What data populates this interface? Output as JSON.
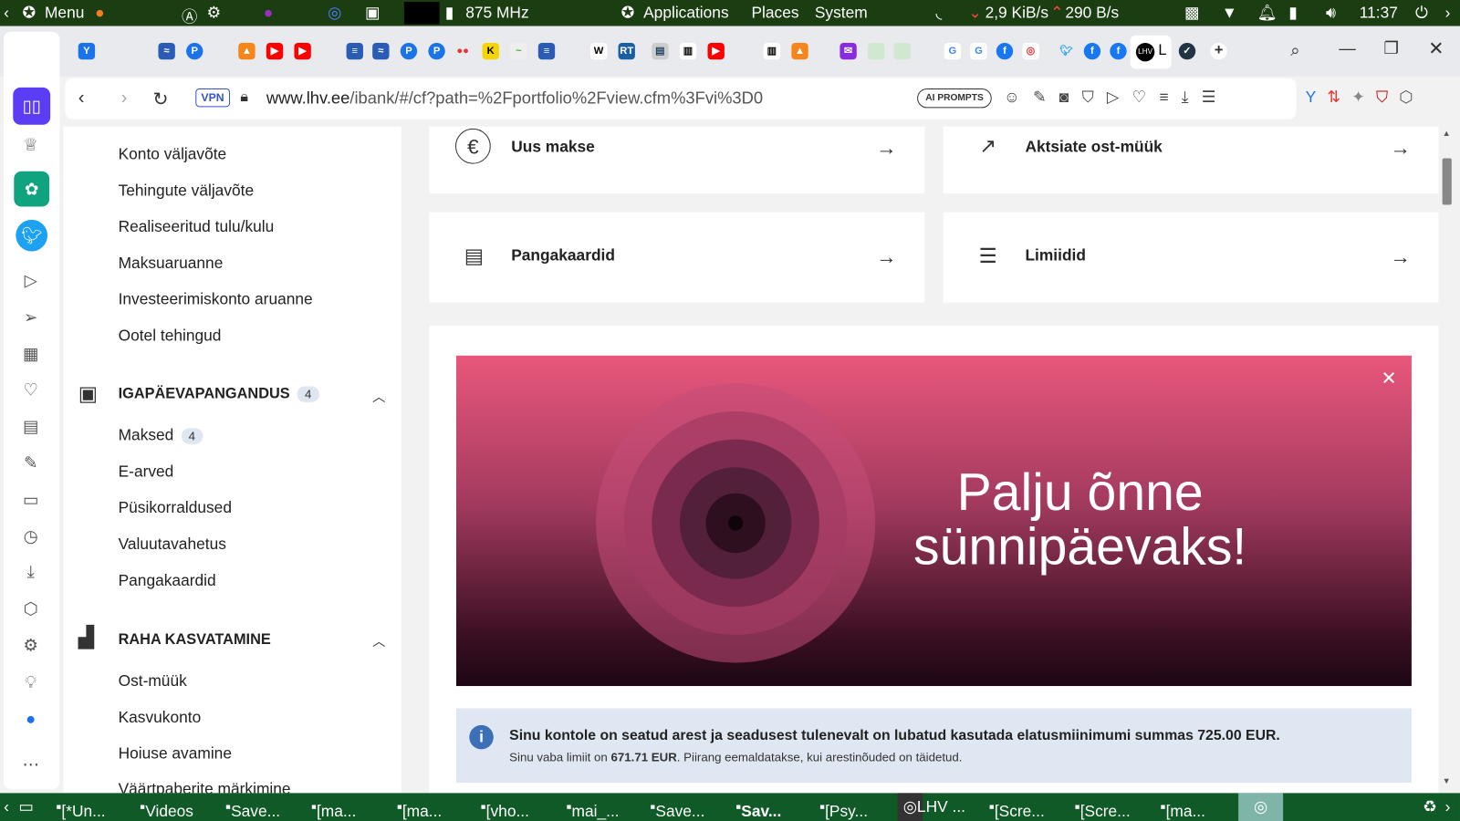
{
  "system_bar": {
    "menu": "Menu",
    "cpu": "875 MHz",
    "applications": "Applications",
    "places": "Places",
    "system": "System",
    "net_down": "2,9 KiB/s",
    "net_up": "290 B/s",
    "time": "11:37"
  },
  "browser": {
    "vpn": "VPN",
    "url_domain": "www.lhv.ee",
    "url_path": "/ibank/#/cf?path=%2Fportfolio%2Fview.cfm%3Fvi%3D0",
    "ai_prompts": "AI PROMPTS"
  },
  "sidebar": {
    "items_top": [
      "Konto väljavõte",
      "Tehingute väljavõte",
      "Realiseeritud tulu/kulu",
      "Maksuaruanne",
      "Investeerimiskonto aruanne",
      "Ootel tehingud"
    ],
    "section1": {
      "title": "IGAPÄEVAPANGANDUS",
      "count": "4",
      "items": [
        "Maksed",
        "E-arved",
        "Püsikorraldused",
        "Valuutavahetus",
        "Pangakaardid"
      ],
      "maksed_count": "4"
    },
    "section2": {
      "title": "RAHA KASVATAMINE",
      "items": [
        "Ost-müük",
        "Kasvukonto",
        "Hoiuse avamine",
        "Väärtpaberite märkimine"
      ]
    }
  },
  "cards": [
    {
      "label": "Uus makse"
    },
    {
      "label": "Aktsiate ost-müük"
    },
    {
      "label": "Pangakaardid"
    },
    {
      "label": "Limiidid"
    }
  ],
  "banner": {
    "line1": "Palju õnne",
    "line2": "sünnipäevaks!"
  },
  "notice": {
    "main": "Sinu kontole on seatud arest ja seadusest tulenevalt on lubatud kasutada elatusmiinimumi summas 725.00 EUR.",
    "sub_prefix": "Sinu vaba limiit on ",
    "sub_amount": "671.71 EUR",
    "sub_suffix": ". Piirang eemaldatakse, kui arestinõuded on täidetud."
  },
  "taskbar": [
    "[*Un...",
    "Videos",
    "Save...",
    "[ma...",
    "[ma...",
    "[vho...",
    "mai_...",
    "Save...",
    "Sav...",
    "[Psy...",
    "LHV ...",
    "[Scre...",
    "[Scre...",
    "[ma..."
  ],
  "colors": {
    "topbar": "#1b3d12",
    "taskbar": "#0f5a26",
    "info_icon": "#3b6fb6"
  }
}
